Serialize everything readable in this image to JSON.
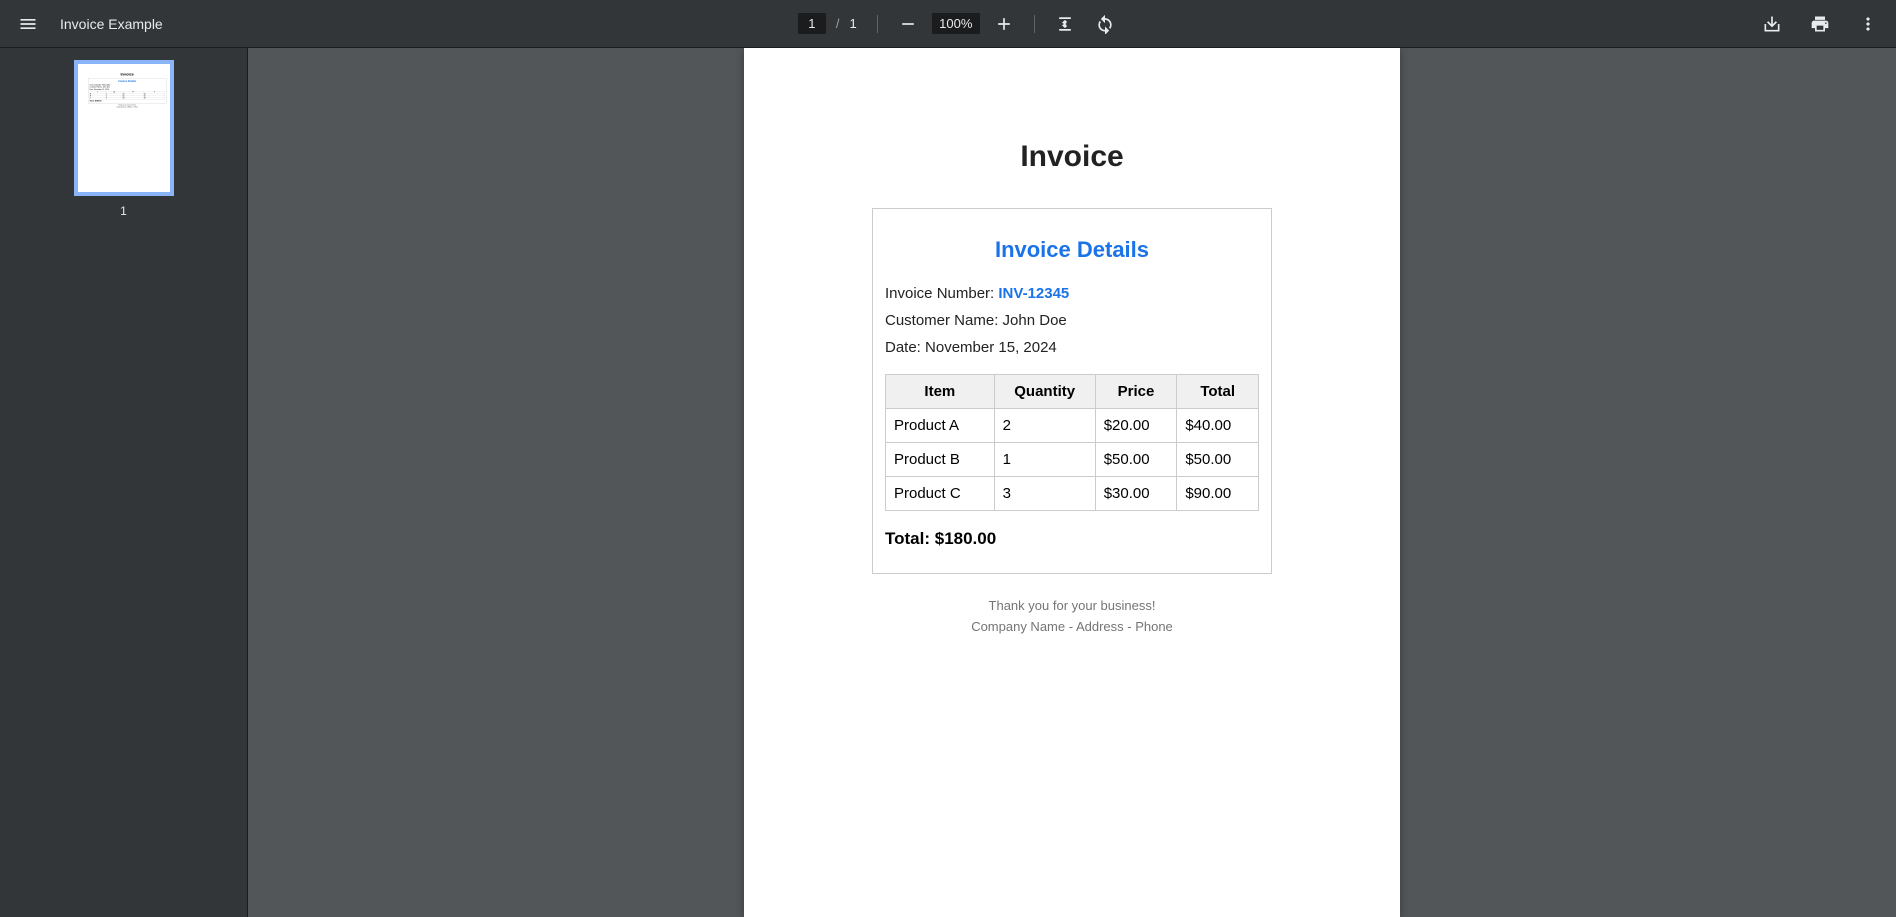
{
  "toolbar": {
    "title": "Invoice Example",
    "current_page": "1",
    "page_separator": "/",
    "total_pages": "1",
    "zoom": "100%"
  },
  "sidebar": {
    "thumb_label": "1"
  },
  "invoice": {
    "title": "Invoice",
    "details_title": "Invoice Details",
    "number_label": "Invoice Number: ",
    "number": "INV-12345",
    "customer_label": "Customer Name: ",
    "customer": "John Doe",
    "date_label": "Date: ",
    "date": "November 15, 2024",
    "headers": {
      "item": "Item",
      "qty": "Quantity",
      "price": "Price",
      "total": "Total"
    },
    "rows": [
      {
        "item": "Product A",
        "qty": "2",
        "price": "$20.00",
        "total": "$40.00"
      },
      {
        "item": "Product B",
        "qty": "1",
        "price": "$50.00",
        "total": "$50.00"
      },
      {
        "item": "Product C",
        "qty": "3",
        "price": "$30.00",
        "total": "$90.00"
      }
    ],
    "total_label": "Total: ",
    "total_value": "$180.00",
    "footer1": "Thank you for your business!",
    "footer2": "Company Name - Address - Phone"
  }
}
